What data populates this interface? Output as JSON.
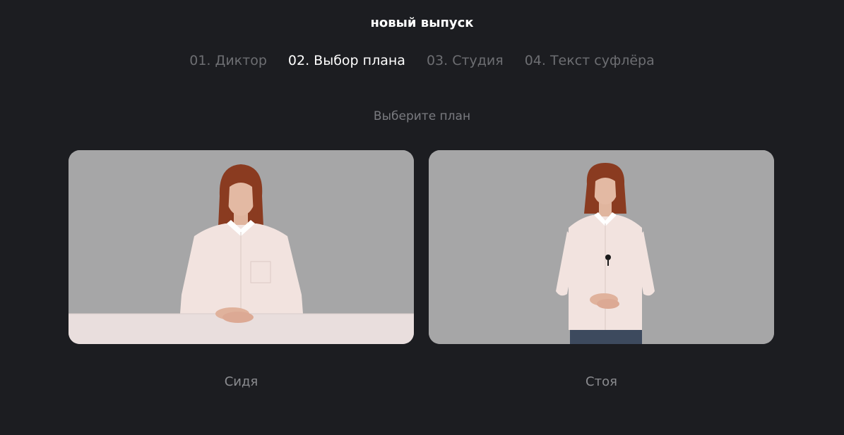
{
  "header": {
    "title": "новый выпуск"
  },
  "steps": [
    {
      "label": "01. Диктор",
      "active": false
    },
    {
      "label": "02. Выбор плана",
      "active": true
    },
    {
      "label": "03. Студия",
      "active": false
    },
    {
      "label": "04. Текст суфлёра",
      "active": false
    }
  ],
  "main": {
    "prompt": "Выберите план",
    "options": [
      {
        "label": "Сидя"
      },
      {
        "label": "Стоя"
      }
    ]
  },
  "colors": {
    "background": "#1c1d21",
    "card_background": "#a6a6a7",
    "active_step": "#ffffff",
    "inactive_step": "#6d6e72"
  }
}
